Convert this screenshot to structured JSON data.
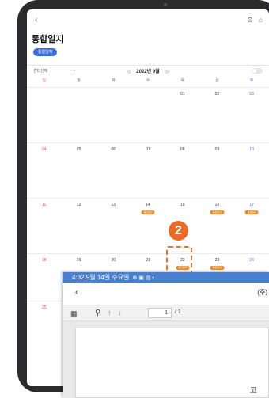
{
  "app": {
    "back": "‹",
    "title": "통합일지",
    "pill": "통합일지",
    "top_icons": "⚙ ⌂"
  },
  "filter": {
    "select_value": "센터선택",
    "prev": "◁",
    "next": "▷",
    "month": "2022년 9월"
  },
  "weekdays": [
    "일",
    "월",
    "화",
    "수",
    "목",
    "금",
    "토"
  ],
  "weeks": [
    [
      "",
      "",
      "",
      "",
      "01",
      "02",
      "03"
    ],
    [
      "04",
      "05",
      "06",
      "07",
      "08",
      "09",
      "10"
    ],
    [
      "11",
      "12",
      "13",
      "14",
      "15",
      "16",
      "17"
    ],
    [
      "18",
      "19",
      "20",
      "21",
      "22",
      "23",
      "24"
    ],
    [
      "25",
      "",
      "",
      "",
      "",
      "",
      ""
    ]
  ],
  "tags": {
    "tag_label": "통합일지"
  },
  "step_badge": "2",
  "overlay": {
    "status": "4:32  9월 14일 수요일",
    "status_icons": "⊕ ▣ ▤ •",
    "back": "‹",
    "company": "(주)",
    "page_value": "1",
    "page_total": "/ 1",
    "doc_char": "고"
  },
  "colors": {
    "accent": "#3a6fd8",
    "tag": "#e98a2b",
    "step": "#ec6a24",
    "overlay_status": "#4a7fcf",
    "sunday": "#d9534f"
  }
}
